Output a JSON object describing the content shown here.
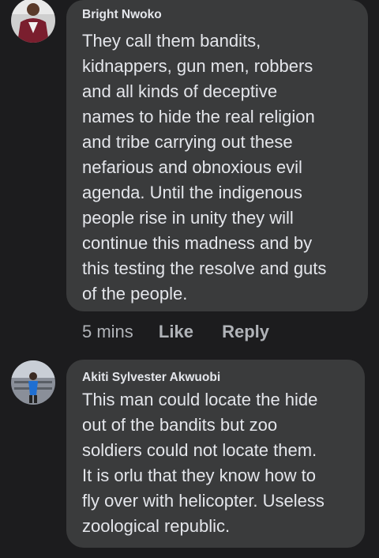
{
  "comments": [
    {
      "author": "Bright Nwoko",
      "avatar_icon": "user-photo-icon",
      "lines": [
        "They call them bandits,",
        "kidnappers, gun men, robbers",
        "and all kinds of deceptive",
        "names to hide the real religion",
        "and tribe carrying out these",
        "nefarious and obnoxious evil",
        "agenda. Until the indigenous",
        "people rise in unity they will",
        "continue this madness and by",
        "this testing the resolve and guts",
        "of the people."
      ],
      "time": "5 mins",
      "like_label": "Like",
      "reply_label": "Reply"
    },
    {
      "author": "Akiti Sylvester Akwuobi",
      "avatar_icon": "user-photo-icon",
      "lines": [
        "This man could locate the hide",
        "out of the bandits but zoo",
        "soldiers could not locate them.",
        "It is orlu that they know how to",
        "fly over with helicopter. Useless",
        "zoological republic."
      ]
    }
  ],
  "colors": {
    "background": "#1c1c1e",
    "bubble": "#3a3b3c",
    "text": "#e4e6eb",
    "secondary_text": "#b0b3b8"
  }
}
